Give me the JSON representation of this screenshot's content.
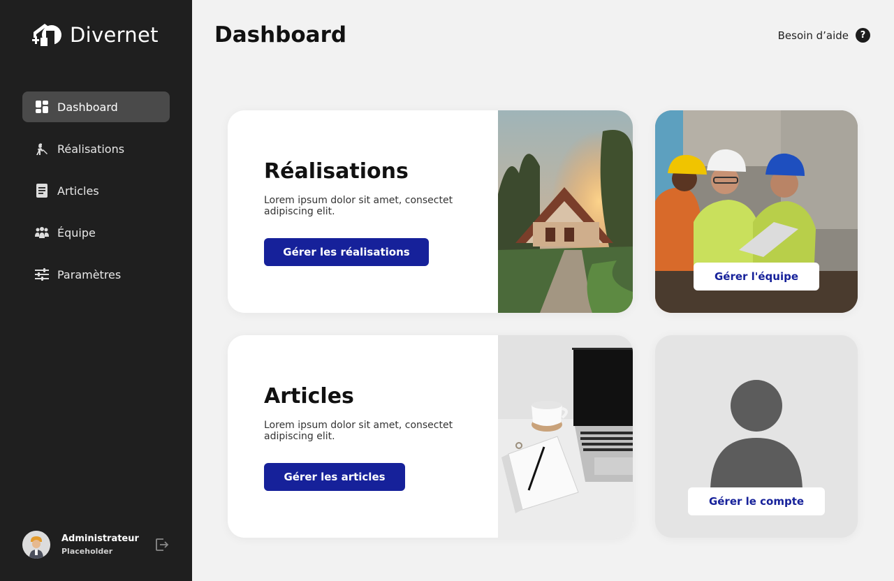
{
  "brand": {
    "name": "Divernet",
    "logo_icon": "house-logo-icon"
  },
  "nav": {
    "items": [
      {
        "label": "Dashboard",
        "icon": "dashboard-icon",
        "active": true
      },
      {
        "label": "Réalisations",
        "icon": "worker-icon",
        "active": false
      },
      {
        "label": "Articles",
        "icon": "document-icon",
        "active": false
      },
      {
        "label": "Équipe",
        "icon": "team-icon",
        "active": false
      },
      {
        "label": "Paramètres",
        "icon": "sliders-icon",
        "active": false
      }
    ]
  },
  "user": {
    "name": "Administrateur",
    "role": "Placeholder",
    "logout_icon": "logout-icon"
  },
  "header": {
    "title": "Dashboard",
    "help_label": "Besoin d’aide",
    "help_icon_glyph": "?"
  },
  "cards": {
    "realisations": {
      "title": "Réalisations",
      "description": "Lorem ipsum dolor sit amet, consectet adipiscing elit.",
      "button": "Gérer les réalisations"
    },
    "articles": {
      "title": "Articles",
      "description": "Lorem ipsum dolor sit amet, consectet adipiscing elit.",
      "button": "Gérer les articles"
    },
    "equipe": {
      "button": "Gérer l'équipe"
    },
    "compte": {
      "button": "Gérer le compte"
    }
  },
  "colors": {
    "sidebar_bg": "#1f1f1f",
    "page_bg": "#f2f2f2",
    "accent": "#16219a",
    "active_nav": "#4a4a4a"
  }
}
